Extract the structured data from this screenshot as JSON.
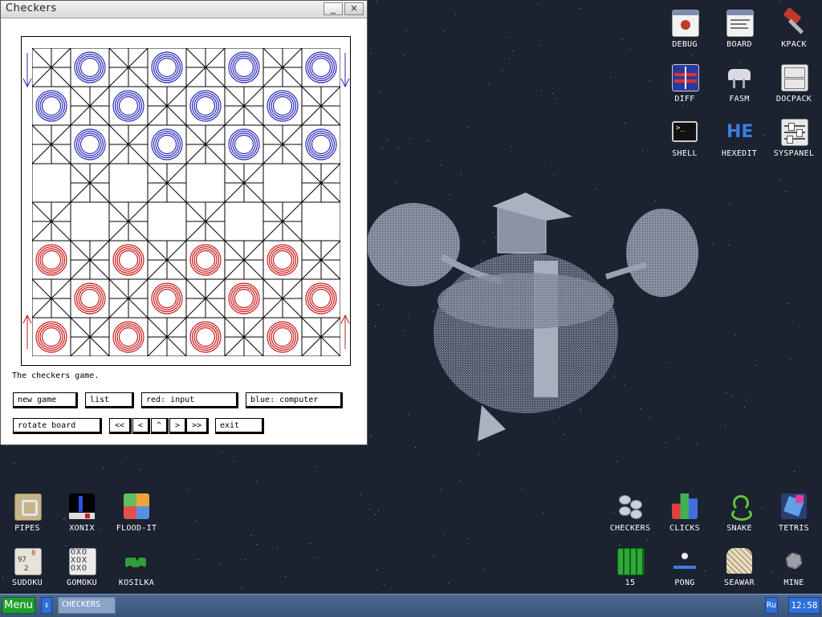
{
  "window": {
    "title": "Checkers",
    "minimize": "_",
    "close": "×",
    "status_text": "The checkers game.",
    "buttons": {
      "new_game": "new game",
      "list": "list",
      "red": "red: input",
      "blue": "blue: computer",
      "rotate": "rotate board",
      "first": "<<",
      "prev": "<",
      "up": "^",
      "next": ">",
      "last": ">>",
      "exit": "exit"
    }
  },
  "board": {
    "size": 8,
    "colors": {
      "blue": "#2a2ab8",
      "red": "#c81a1a",
      "grid": "#000000"
    },
    "pieces": [
      [
        null,
        "blue",
        null,
        "blue",
        null,
        "blue",
        null,
        "blue"
      ],
      [
        "blue",
        null,
        "blue",
        null,
        "blue",
        null,
        "blue",
        null
      ],
      [
        null,
        "blue",
        null,
        "blue",
        null,
        "blue",
        null,
        "blue"
      ],
      [
        null,
        null,
        null,
        null,
        null,
        null,
        null,
        null
      ],
      [
        null,
        null,
        null,
        null,
        null,
        null,
        null,
        null
      ],
      [
        "red",
        null,
        "red",
        null,
        "red",
        null,
        "red",
        null
      ],
      [
        null,
        "red",
        null,
        "red",
        null,
        "red",
        null,
        "red"
      ],
      [
        "red",
        null,
        "red",
        null,
        "red",
        null,
        "red",
        null
      ]
    ]
  },
  "desktop_icons": {
    "debug": {
      "label": "DEBUG",
      "icon": "bug-window-icon"
    },
    "board": {
      "label": "BOARD",
      "icon": "board-window-icon"
    },
    "kpack": {
      "label": "KPACK",
      "icon": "hammer-icon"
    },
    "diff": {
      "label": "DIFF",
      "icon": "diff-icon"
    },
    "fasm": {
      "label": "FASM",
      "icon": "fasm-icon"
    },
    "docpack": {
      "label": "DOCPACK",
      "icon": "cabinet-icon"
    },
    "shell": {
      "label": "SHELL",
      "icon": "terminal-icon"
    },
    "hexedit": {
      "label": "HEXEDIT",
      "icon": "he-icon"
    },
    "syspanel": {
      "label": "SYSPANEL",
      "icon": "sliders-icon"
    },
    "pipes": {
      "label": "PIPES",
      "icon": "pipes-icon"
    },
    "xonix": {
      "label": "XONIX",
      "icon": "xonix-icon"
    },
    "floodit": {
      "label": "FLOOD-IT",
      "icon": "flood-icon"
    },
    "sudoku": {
      "label": "SUDOKU",
      "icon": "sudoku-icon"
    },
    "gomoku": {
      "label": "GOMOKU",
      "icon": "gomoku-icon"
    },
    "kosilka": {
      "label": "KOSILKA",
      "icon": "mower-icon"
    },
    "checkers": {
      "label": "CHECKERS",
      "icon": "checkers-icon"
    },
    "clicks": {
      "label": "CLICKS",
      "icon": "clicks-icon"
    },
    "snake": {
      "label": "SNAKE",
      "icon": "snake-icon"
    },
    "tetris": {
      "label": "TETRIS",
      "icon": "tetris-icon"
    },
    "fifteen": {
      "label": "15",
      "icon": "fifteen-icon"
    },
    "pong": {
      "label": "PONG",
      "icon": "pong-icon"
    },
    "seawar": {
      "label": "SEAWAR",
      "icon": "seawar-icon"
    },
    "mine": {
      "label": "MINE",
      "icon": "mine-icon"
    }
  },
  "taskbar": {
    "menu": "Menu",
    "arrow": "↕",
    "task": "CHECKERS",
    "lang": "Ru",
    "clock": "12:58"
  }
}
